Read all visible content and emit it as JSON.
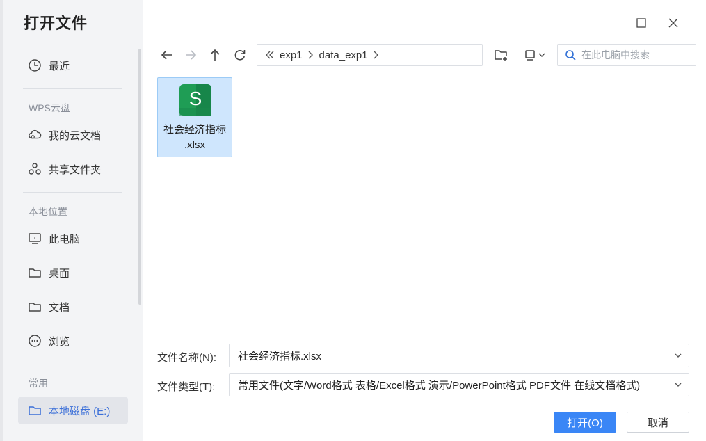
{
  "dialog": {
    "title": "打开文件"
  },
  "sidebar": {
    "recent": {
      "label": "最近",
      "icon": "clock-icon"
    },
    "cloud_section": "WPS云盘",
    "cloud_items": [
      {
        "label": "我的云文档",
        "icon": "cloud-icon"
      },
      {
        "label": "共享文件夹",
        "icon": "share-icon"
      }
    ],
    "local_section": "本地位置",
    "local_items": [
      {
        "label": "此电脑",
        "icon": "monitor-icon"
      },
      {
        "label": "桌面",
        "icon": "folder-icon"
      },
      {
        "label": "文档",
        "icon": "folder-icon"
      },
      {
        "label": "浏览",
        "icon": "more-icon"
      }
    ],
    "common_section": "常用",
    "common_items": [
      {
        "label": "本地磁盘 (E:)",
        "icon": "folder-icon",
        "active": true
      }
    ]
  },
  "toolbar": {
    "path": [
      "exp1",
      "data_exp1"
    ],
    "search_placeholder": "在此电脑中搜索"
  },
  "files": [
    {
      "name_line1": "社会经济指标",
      "name_line2": ".xlsx",
      "icon_letter": "S",
      "selected": true
    }
  ],
  "form": {
    "filename_label": "文件名称(N):",
    "filename_value": "社会经济指标.xlsx",
    "filetype_label": "文件类型(T):",
    "filetype_value": "常用文件(文字/Word格式 表格/Excel格式 演示/PowerPoint格式 PDF文件 在线文档格式)"
  },
  "buttons": {
    "open": "打开(O)",
    "cancel": "取消"
  },
  "colors": {
    "accent": "#3a86f6",
    "sidebar_bg": "#f3f4f6",
    "selected_bg": "#cfe6fd",
    "sheet_green": "#1f9d55"
  }
}
